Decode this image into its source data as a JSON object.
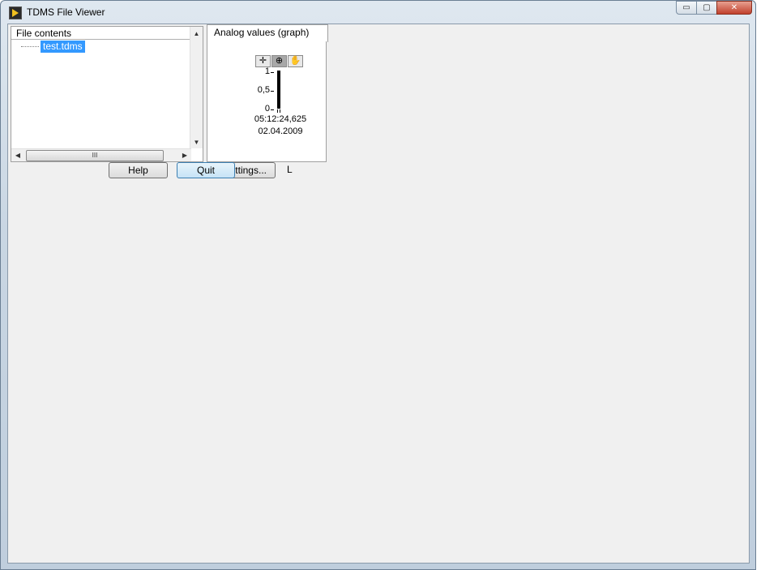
{
  "window": {
    "title": "TDMS File Viewer",
    "buttons": {
      "minimize": "▭",
      "maximize": "▢",
      "close": "✕"
    }
  },
  "file_tree": {
    "header": "File contents",
    "items": [
      {
        "label": "test.tdms",
        "selected": true
      }
    ],
    "hscroll_grip": "III"
  },
  "graph": {
    "tab_label": "Analog values (graph)",
    "y_ticks": [
      "1",
      "0,5",
      "0"
    ],
    "x_time": "05:12:24,625",
    "x_date": "02.04.2009"
  },
  "buttons": {
    "help": "Help",
    "quit": "Quit",
    "settings": "Settings...",
    "indicator": "L"
  },
  "colors": {
    "selection": "#3399ff",
    "panel": "#f0f0f0"
  }
}
